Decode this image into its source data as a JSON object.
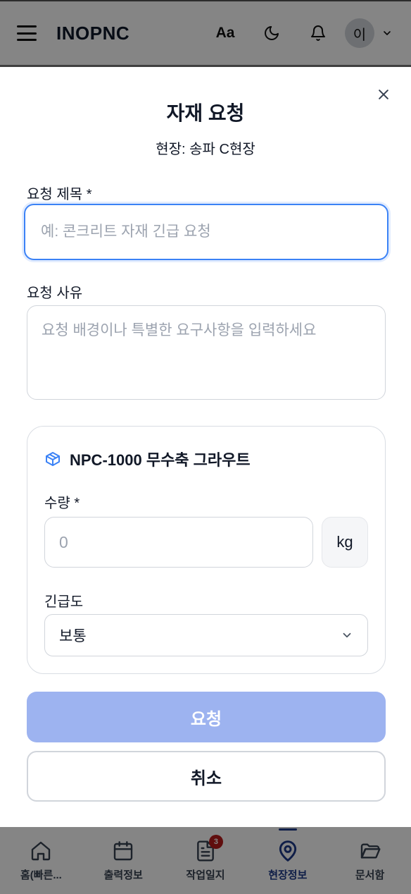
{
  "header": {
    "logo": "INOPNC",
    "font_toggle": "Aa",
    "avatar_initial": "이",
    "icons": [
      "menu-icon",
      "font-size-icon",
      "moon-icon",
      "bell-icon",
      "chevron-down-icon"
    ]
  },
  "modal": {
    "title": "자재 요청",
    "subtitle": "현장: 송파 C현장",
    "request_title": {
      "label": "요청 제목 *",
      "placeholder": "예: 콘크리트 자재 긴급 요청",
      "value": ""
    },
    "request_reason": {
      "label": "요청 사유",
      "placeholder": "요청 배경이나 특별한 요구사항을 입력하세요",
      "value": ""
    },
    "material": {
      "name": "NPC-1000 무수축 그라우트",
      "icon": "box-icon",
      "quantity": {
        "label": "수량 *",
        "placeholder": "0",
        "unit": "kg"
      },
      "urgency": {
        "label": "긴급도",
        "selected": "보통"
      }
    },
    "submit_label": "요청",
    "cancel_label": "취소"
  },
  "bottom_nav": {
    "items": [
      {
        "label": "홈(빠른...",
        "icon": "home-icon"
      },
      {
        "label": "출력정보",
        "icon": "calendar-icon"
      },
      {
        "label": "작업일지",
        "icon": "document-icon",
        "badge": "3"
      },
      {
        "label": "현장정보",
        "icon": "map-pin-icon",
        "active": true
      },
      {
        "label": "문서함",
        "icon": "folder-icon"
      }
    ]
  },
  "colors": {
    "accent": "#3b82f6",
    "submit_disabled": "#9db3f0",
    "active_nav": "#1e3a8a",
    "badge": "#b91c1c"
  }
}
